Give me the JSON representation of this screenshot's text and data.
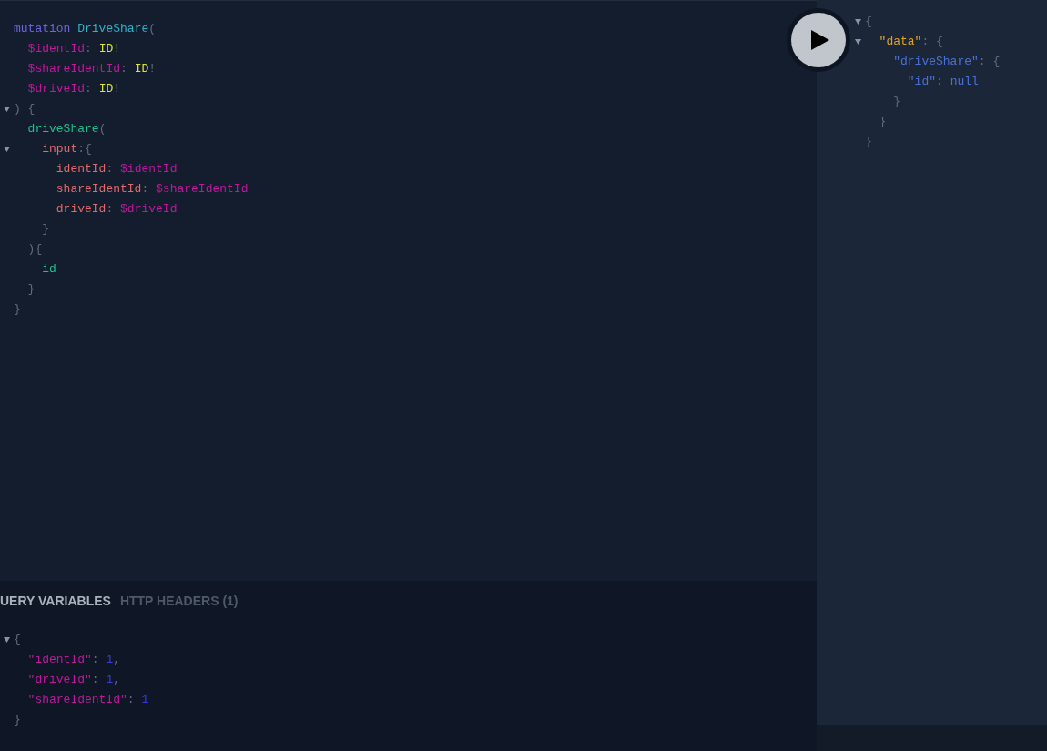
{
  "query_editor": {
    "lines": [
      {
        "foldable": false,
        "tokens": [
          {
            "kind": "keyword",
            "text": "mutation "
          },
          {
            "kind": "def",
            "text": "DriveShare"
          },
          {
            "kind": "punct",
            "text": "("
          }
        ]
      },
      {
        "foldable": false,
        "tokens": [
          {
            "kind": "variable",
            "text": "  $identId"
          },
          {
            "kind": "punct",
            "text": ": "
          },
          {
            "kind": "type",
            "text": "ID"
          },
          {
            "kind": "punct",
            "text": "!"
          }
        ]
      },
      {
        "foldable": false,
        "tokens": [
          {
            "kind": "variable",
            "text": "  $shareIdentId"
          },
          {
            "kind": "punct",
            "text": ": "
          },
          {
            "kind": "type",
            "text": "ID"
          },
          {
            "kind": "punct",
            "text": "!"
          }
        ]
      },
      {
        "foldable": false,
        "tokens": [
          {
            "kind": "variable",
            "text": "  $driveId"
          },
          {
            "kind": "punct",
            "text": ": "
          },
          {
            "kind": "type",
            "text": "ID"
          },
          {
            "kind": "punct",
            "text": "!"
          }
        ]
      },
      {
        "foldable": true,
        "tokens": [
          {
            "kind": "punct",
            "text": ") {"
          }
        ]
      },
      {
        "foldable": false,
        "tokens": [
          {
            "kind": "field",
            "text": "  driveShare"
          },
          {
            "kind": "punct",
            "text": "("
          }
        ]
      },
      {
        "foldable": true,
        "tokens": [
          {
            "kind": "argument",
            "text": "    input"
          },
          {
            "kind": "punct",
            "text": ":{"
          }
        ]
      },
      {
        "foldable": false,
        "tokens": [
          {
            "kind": "argument",
            "text": "      identId"
          },
          {
            "kind": "punct",
            "text": ": "
          },
          {
            "kind": "variable",
            "text": "$identId"
          }
        ]
      },
      {
        "foldable": false,
        "tokens": [
          {
            "kind": "argument",
            "text": "      shareIdentId"
          },
          {
            "kind": "punct",
            "text": ": "
          },
          {
            "kind": "variable",
            "text": "$shareIdentId"
          }
        ]
      },
      {
        "foldable": false,
        "tokens": [
          {
            "kind": "argument",
            "text": "      driveId"
          },
          {
            "kind": "punct",
            "text": ": "
          },
          {
            "kind": "variable",
            "text": "$driveId"
          }
        ]
      },
      {
        "foldable": false,
        "tokens": [
          {
            "kind": "punct",
            "text": "    }"
          }
        ]
      },
      {
        "foldable": false,
        "tokens": [
          {
            "kind": "punct",
            "text": "  ){"
          }
        ]
      },
      {
        "foldable": false,
        "tokens": [
          {
            "kind": "field",
            "text": "    id"
          }
        ]
      },
      {
        "foldable": false,
        "tokens": [
          {
            "kind": "punct",
            "text": "  }"
          }
        ]
      },
      {
        "foldable": false,
        "tokens": [
          {
            "kind": "punct",
            "text": "}"
          }
        ]
      }
    ]
  },
  "tabs": [
    {
      "label": "UERY VARIABLES",
      "selected": true
    },
    {
      "label": "HTTP HEADERS (1)",
      "selected": false
    }
  ],
  "variables_editor": {
    "lines": [
      {
        "foldable": true,
        "tokens": [
          {
            "kind": "punct",
            "text": "{"
          }
        ]
      },
      {
        "foldable": false,
        "tokens": [
          {
            "kind": "variable",
            "text": "  \"identId\""
          },
          {
            "kind": "punct",
            "text": ": "
          },
          {
            "kind": "number",
            "text": "1"
          },
          {
            "kind": "punct",
            "text": ","
          }
        ]
      },
      {
        "foldable": false,
        "tokens": [
          {
            "kind": "variable",
            "text": "  \"driveId\""
          },
          {
            "kind": "punct",
            "text": ": "
          },
          {
            "kind": "number",
            "text": "1"
          },
          {
            "kind": "punct",
            "text": ","
          }
        ]
      },
      {
        "foldable": false,
        "tokens": [
          {
            "kind": "variable",
            "text": "  \"shareIdentId\""
          },
          {
            "kind": "punct",
            "text": ": "
          },
          {
            "kind": "number",
            "text": "1"
          }
        ]
      },
      {
        "foldable": false,
        "tokens": [
          {
            "kind": "punct",
            "text": "}"
          }
        ]
      }
    ]
  },
  "result": {
    "lines": [
      {
        "foldable": true,
        "tokens": [
          {
            "kind": "punct",
            "text": "{"
          }
        ]
      },
      {
        "foldable": true,
        "tokens": [
          {
            "kind": "key",
            "text": "  \"data\""
          },
          {
            "kind": "punct",
            "text": ": {"
          }
        ]
      },
      {
        "foldable": false,
        "tokens": [
          {
            "kind": "string",
            "text": "    \"driveShare\""
          },
          {
            "kind": "punct",
            "text": ": {"
          }
        ]
      },
      {
        "foldable": false,
        "tokens": [
          {
            "kind": "string",
            "text": "      \"id\""
          },
          {
            "kind": "punct",
            "text": ": "
          },
          {
            "kind": "string",
            "text": "null"
          }
        ]
      },
      {
        "foldable": false,
        "tokens": [
          {
            "kind": "punct",
            "text": "    }"
          }
        ]
      },
      {
        "foldable": false,
        "tokens": [
          {
            "kind": "punct",
            "text": "  }"
          }
        ]
      },
      {
        "foldable": false,
        "tokens": [
          {
            "kind": "punct",
            "text": "}"
          }
        ]
      }
    ]
  }
}
